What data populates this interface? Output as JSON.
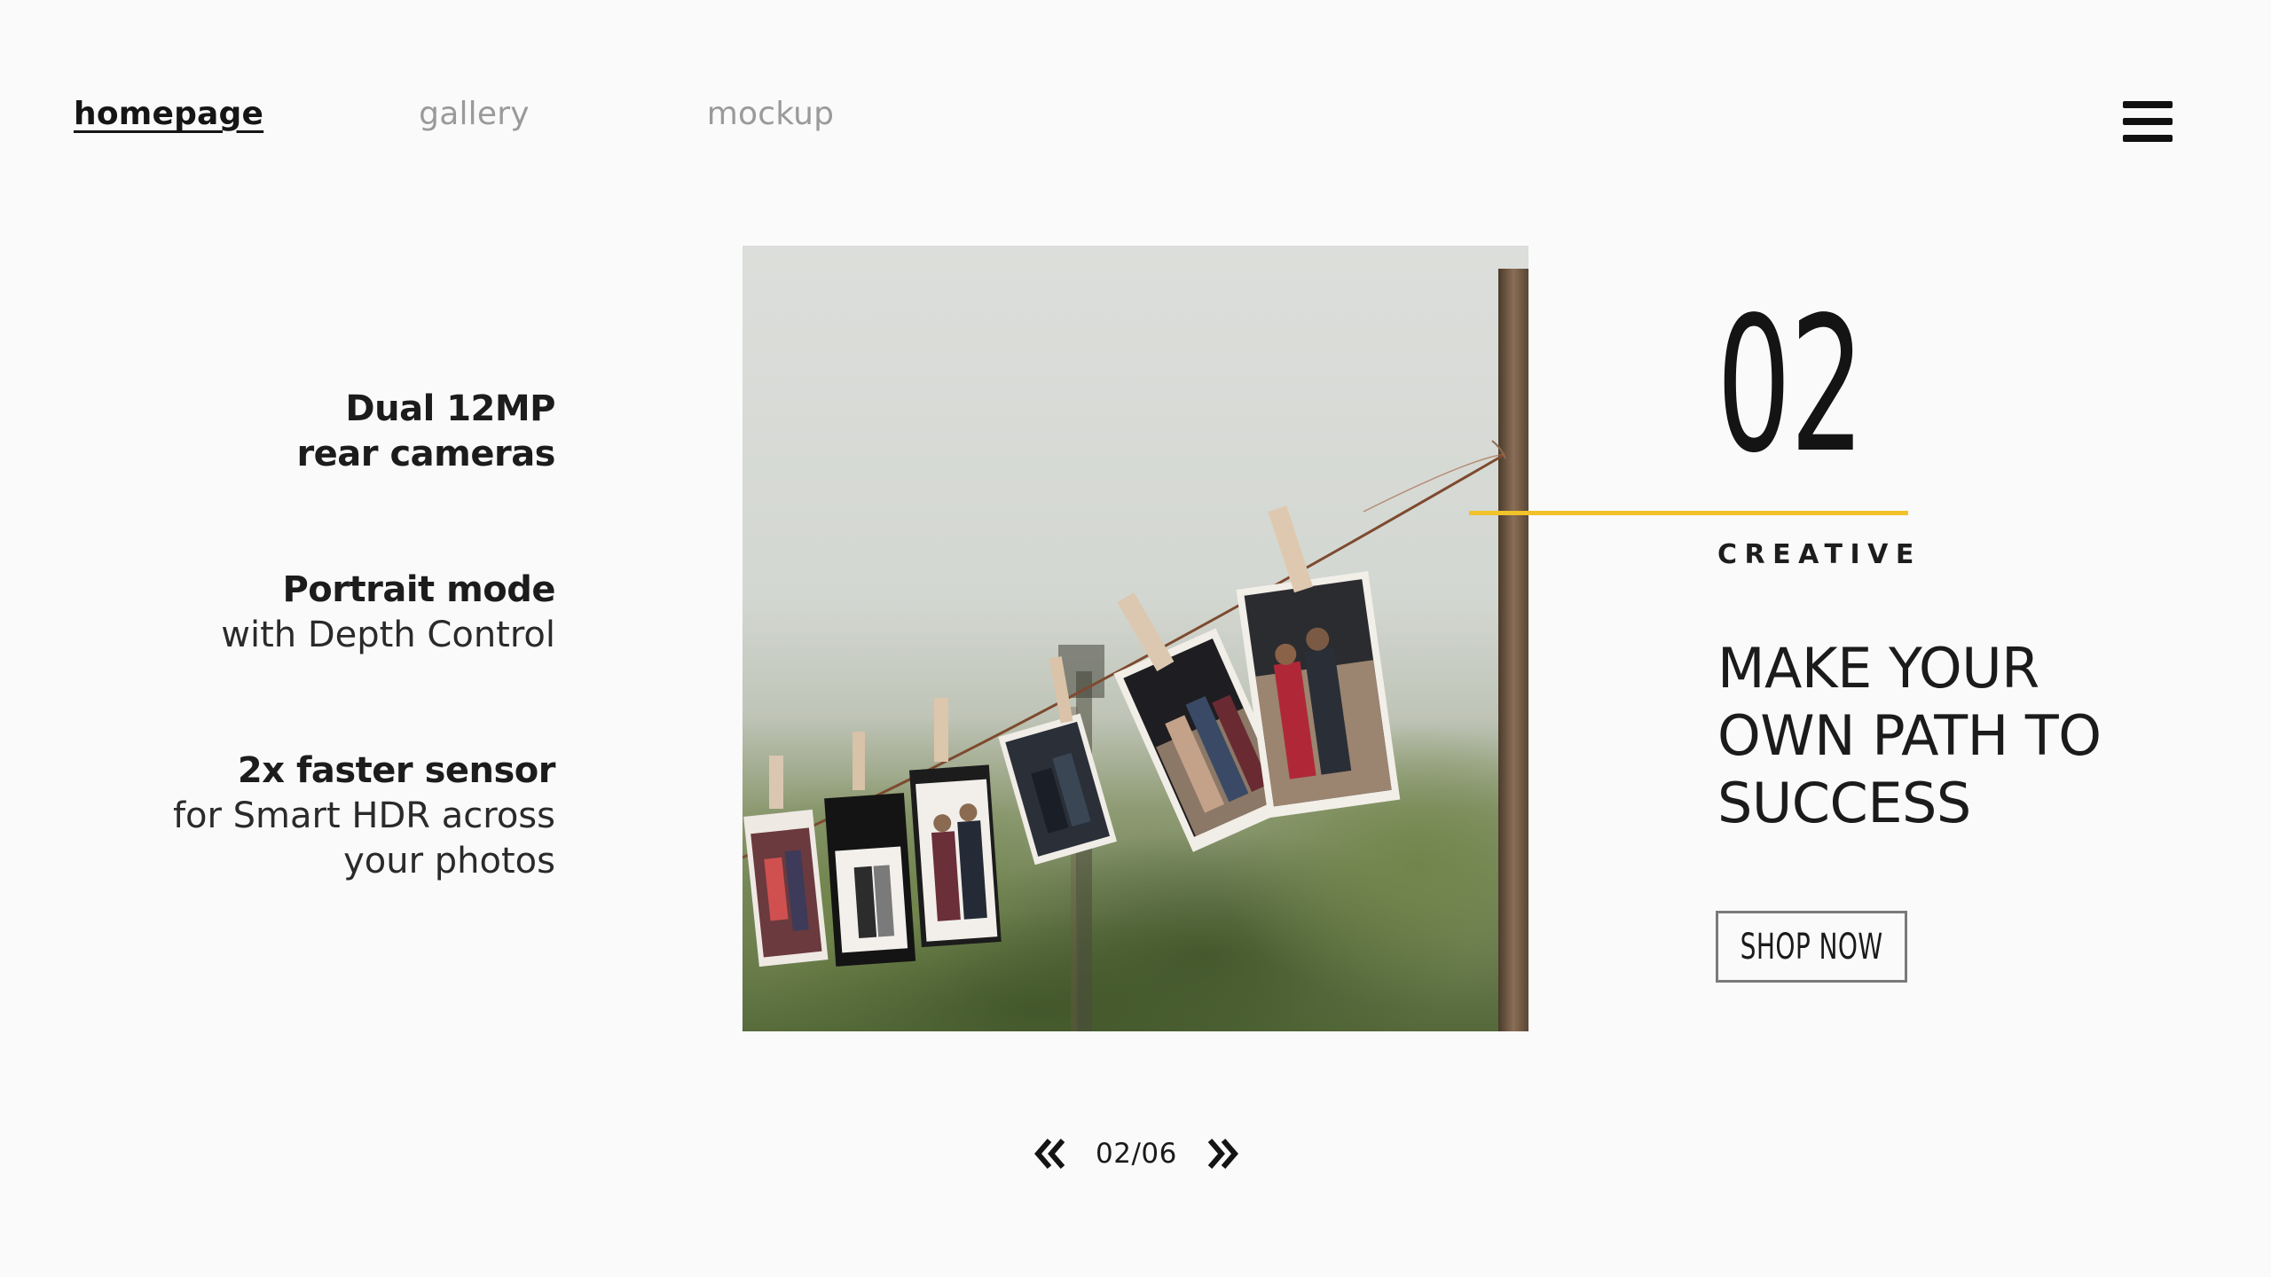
{
  "nav": {
    "items": [
      {
        "label": "homepage",
        "active": true
      },
      {
        "label": "gallery",
        "active": false
      },
      {
        "label": "mockup",
        "active": false
      }
    ],
    "menu_icon": "hamburger-menu-icon"
  },
  "features": [
    {
      "title": "Dual 12MP",
      "subtitle": "rear cameras",
      "subtitle_bold": true
    },
    {
      "title": "Portrait mode",
      "subtitle": "with Depth Control",
      "subtitle_bold": false
    },
    {
      "title": "2x faster sensor",
      "subtitle_lines": [
        "for Smart HDR across",
        "your photos"
      ],
      "subtitle_bold": false
    }
  ],
  "slide": {
    "number": "02",
    "category": "CREATIVE",
    "headline_lines": [
      "MAKE YOUR",
      "OWN PATH TO",
      "SUCCESS"
    ],
    "cta_label": "SHOP NOW"
  },
  "pager": {
    "counter": "02/06",
    "prev_icon": "double-chevron-left-icon",
    "next_icon": "double-chevron-right-icon"
  },
  "colors": {
    "accent": "#f1c22a",
    "background": "#fafafa",
    "text": "#1a1a1a",
    "muted_nav": "#9a9a9a"
  }
}
